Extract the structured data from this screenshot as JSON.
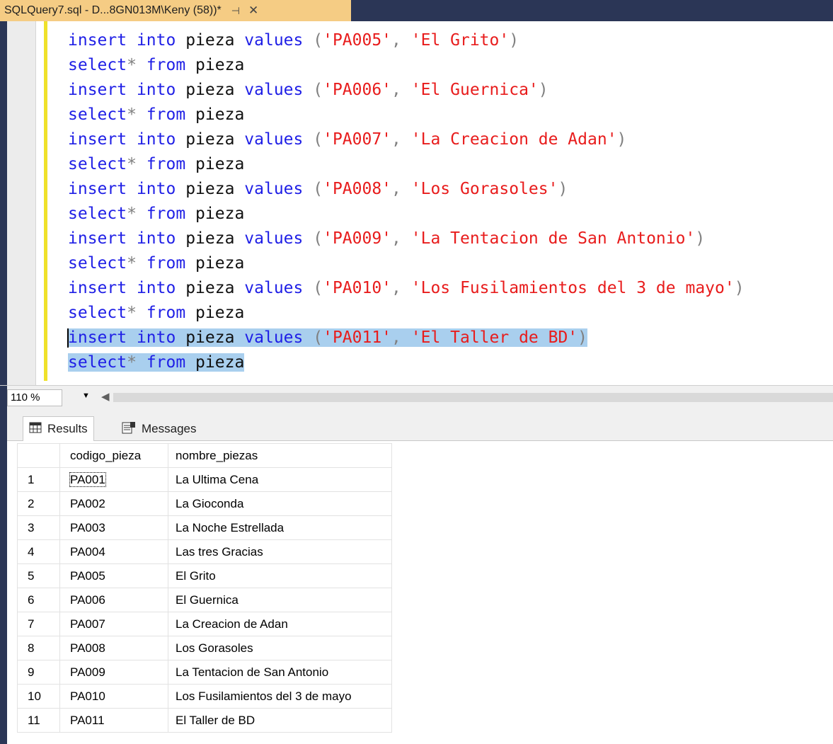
{
  "tab": {
    "title": "SQLQuery7.sql - D...8GN013M\\Keny (58))*",
    "pin_icon": "pin-icon",
    "close_icon": "close-icon"
  },
  "editor": {
    "lines": [
      {
        "selected": false,
        "tokens": [
          [
            "kw",
            "insert"
          ],
          [
            "id",
            " "
          ],
          [
            "kw",
            "into"
          ],
          [
            "id",
            " pieza "
          ],
          [
            "kw",
            "values"
          ],
          [
            "id",
            " "
          ],
          [
            "op",
            "("
          ],
          [
            "str",
            "'PA005'"
          ],
          [
            "op",
            ","
          ],
          [
            "id",
            " "
          ],
          [
            "str",
            "'El Grito'"
          ],
          [
            "op",
            ")"
          ]
        ]
      },
      {
        "selected": false,
        "tokens": [
          [
            "kw",
            "select"
          ],
          [
            "op",
            "*"
          ],
          [
            "id",
            " "
          ],
          [
            "kw",
            "from"
          ],
          [
            "id",
            " pieza"
          ]
        ]
      },
      {
        "selected": false,
        "tokens": [
          [
            "kw",
            "insert"
          ],
          [
            "id",
            " "
          ],
          [
            "kw",
            "into"
          ],
          [
            "id",
            " pieza "
          ],
          [
            "kw",
            "values"
          ],
          [
            "id",
            " "
          ],
          [
            "op",
            "("
          ],
          [
            "str",
            "'PA006'"
          ],
          [
            "op",
            ","
          ],
          [
            "id",
            " "
          ],
          [
            "str",
            "'El Guernica'"
          ],
          [
            "op",
            ")"
          ]
        ]
      },
      {
        "selected": false,
        "tokens": [
          [
            "kw",
            "select"
          ],
          [
            "op",
            "*"
          ],
          [
            "id",
            " "
          ],
          [
            "kw",
            "from"
          ],
          [
            "id",
            " pieza"
          ]
        ]
      },
      {
        "selected": false,
        "tokens": [
          [
            "kw",
            "insert"
          ],
          [
            "id",
            " "
          ],
          [
            "kw",
            "into"
          ],
          [
            "id",
            " pieza "
          ],
          [
            "kw",
            "values"
          ],
          [
            "id",
            " "
          ],
          [
            "op",
            "("
          ],
          [
            "str",
            "'PA007'"
          ],
          [
            "op",
            ","
          ],
          [
            "id",
            " "
          ],
          [
            "str",
            "'La Creacion de Adan'"
          ],
          [
            "op",
            ")"
          ]
        ]
      },
      {
        "selected": false,
        "tokens": [
          [
            "kw",
            "select"
          ],
          [
            "op",
            "*"
          ],
          [
            "id",
            " "
          ],
          [
            "kw",
            "from"
          ],
          [
            "id",
            " pieza"
          ]
        ]
      },
      {
        "selected": false,
        "tokens": [
          [
            "kw",
            "insert"
          ],
          [
            "id",
            " "
          ],
          [
            "kw",
            "into"
          ],
          [
            "id",
            " pieza "
          ],
          [
            "kw",
            "values"
          ],
          [
            "id",
            " "
          ],
          [
            "op",
            "("
          ],
          [
            "str",
            "'PA008'"
          ],
          [
            "op",
            ","
          ],
          [
            "id",
            " "
          ],
          [
            "str",
            "'Los Gorasoles'"
          ],
          [
            "op",
            ")"
          ]
        ]
      },
      {
        "selected": false,
        "tokens": [
          [
            "kw",
            "select"
          ],
          [
            "op",
            "*"
          ],
          [
            "id",
            " "
          ],
          [
            "kw",
            "from"
          ],
          [
            "id",
            " pieza"
          ]
        ]
      },
      {
        "selected": false,
        "tokens": [
          [
            "kw",
            "insert"
          ],
          [
            "id",
            " "
          ],
          [
            "kw",
            "into"
          ],
          [
            "id",
            " pieza "
          ],
          [
            "kw",
            "values"
          ],
          [
            "id",
            " "
          ],
          [
            "op",
            "("
          ],
          [
            "str",
            "'PA009'"
          ],
          [
            "op",
            ","
          ],
          [
            "id",
            " "
          ],
          [
            "str",
            "'La Tentacion de San Antonio'"
          ],
          [
            "op",
            ")"
          ]
        ]
      },
      {
        "selected": false,
        "tokens": [
          [
            "kw",
            "select"
          ],
          [
            "op",
            "*"
          ],
          [
            "id",
            " "
          ],
          [
            "kw",
            "from"
          ],
          [
            "id",
            " pieza"
          ]
        ]
      },
      {
        "selected": false,
        "tokens": [
          [
            "kw",
            "insert"
          ],
          [
            "id",
            " "
          ],
          [
            "kw",
            "into"
          ],
          [
            "id",
            " pieza "
          ],
          [
            "kw",
            "values"
          ],
          [
            "id",
            " "
          ],
          [
            "op",
            "("
          ],
          [
            "str",
            "'PA010'"
          ],
          [
            "op",
            ","
          ],
          [
            "id",
            " "
          ],
          [
            "str",
            "'Los Fusilamientos del 3 de mayo'"
          ],
          [
            "op",
            ")"
          ]
        ]
      },
      {
        "selected": false,
        "tokens": [
          [
            "kw",
            "select"
          ],
          [
            "op",
            "*"
          ],
          [
            "id",
            " "
          ],
          [
            "kw",
            "from"
          ],
          [
            "id",
            " pieza"
          ]
        ]
      },
      {
        "selected": true,
        "tokens": [
          [
            "kw",
            "insert"
          ],
          [
            "id",
            " "
          ],
          [
            "kw",
            "into"
          ],
          [
            "id",
            " pieza "
          ],
          [
            "kw",
            "values"
          ],
          [
            "id",
            " "
          ],
          [
            "op",
            "("
          ],
          [
            "str",
            "'PA011'"
          ],
          [
            "op",
            ","
          ],
          [
            "id",
            " "
          ],
          [
            "str",
            "'El Taller de BD'"
          ],
          [
            "op",
            ")"
          ]
        ]
      },
      {
        "selected": true,
        "tokens": [
          [
            "kw",
            "select"
          ],
          [
            "op",
            "*"
          ],
          [
            "id",
            " "
          ],
          [
            "kw",
            "from"
          ],
          [
            "id",
            " pieza"
          ]
        ]
      }
    ]
  },
  "zoom": {
    "value": "110 %",
    "dropdown_icon": "chevron-down-icon",
    "scroll_left_icon": "scroll-left-icon"
  },
  "results_tabs": {
    "results_label": "Results",
    "messages_label": "Messages"
  },
  "grid": {
    "columns": [
      "",
      "codigo_pieza",
      "nombre_piezas"
    ],
    "rows": [
      [
        "1",
        "PA001",
        "La Ultima Cena"
      ],
      [
        "2",
        "PA002",
        "La Gioconda"
      ],
      [
        "3",
        "PA003",
        "La Noche Estrellada"
      ],
      [
        "4",
        "PA004",
        "Las tres Gracias"
      ],
      [
        "5",
        "PA005",
        "El Grito"
      ],
      [
        "6",
        "PA006",
        "El Guernica"
      ],
      [
        "7",
        "PA007",
        "La Creacion de Adan"
      ],
      [
        "8",
        "PA008",
        "Los Gorasoles"
      ],
      [
        "9",
        "PA009",
        "La Tentacion de San Antonio"
      ],
      [
        "10",
        "PA010",
        "Los Fusilamientos del 3 de mayo"
      ],
      [
        "11",
        "PA011",
        "El Taller de BD"
      ]
    ]
  },
  "colors": {
    "tab_active": "#f5cc84",
    "chrome_dark": "#2b3656",
    "keyword": "#1f1fe6",
    "string": "#e81c1c",
    "selection": "#a9cfee",
    "change_bar": "#efe12a"
  }
}
